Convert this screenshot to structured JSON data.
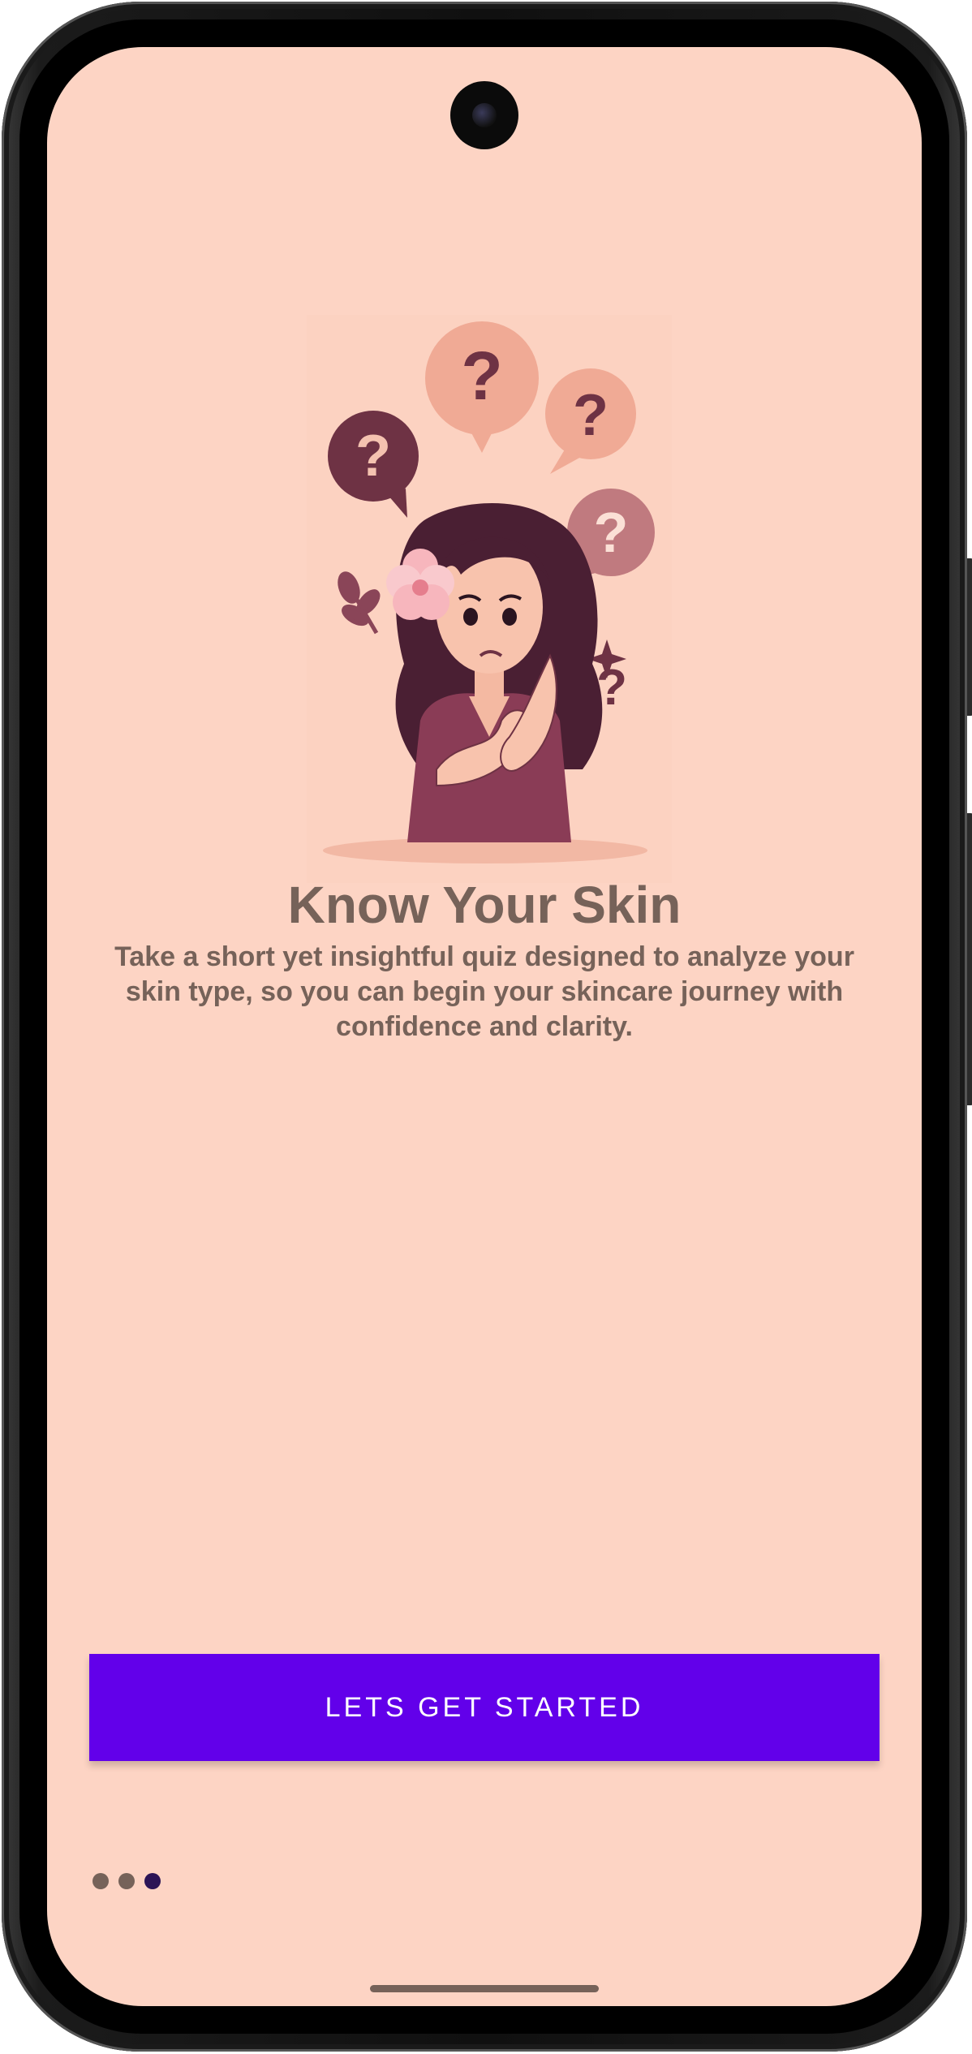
{
  "onboarding": {
    "title": "Know Your Skin",
    "description": "Take a short yet insightful quiz designed to analyze your skin type, so you can begin your skincare journey with confidence and clarity.",
    "cta_label": "LETS GET STARTED",
    "illustration_glyph": "?",
    "illustration_subject": "woman-thinking-illustration"
  },
  "pager": {
    "total": 3,
    "active_index": 2
  },
  "colors": {
    "background": "#fdd4c4",
    "text": "#766259",
    "accent": "#6200ea",
    "dot_active": "#2c1456"
  }
}
